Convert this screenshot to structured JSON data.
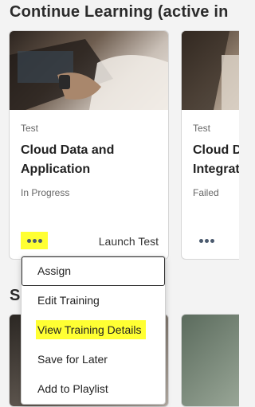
{
  "section": {
    "title": "Continue Learning (active in"
  },
  "cards": [
    {
      "type": "Test",
      "title": "Cloud Data and Application",
      "status": "In Progress",
      "action": "Launch Test"
    },
    {
      "type": "Test",
      "title_line1": "Cloud D",
      "title_line2": "Integrat",
      "status": "Failed"
    }
  ],
  "second_section": {
    "title_visible": "S"
  },
  "menu": {
    "items": [
      "Assign",
      "Edit Training",
      "View Training Details",
      "Save for Later",
      "Add to Playlist"
    ]
  },
  "colors": {
    "highlight": "#ffff33",
    "dots": "#4a5a6e",
    "background": "#f3f3f3"
  },
  "icons": {
    "more_options": "three-dots-horizontal"
  }
}
